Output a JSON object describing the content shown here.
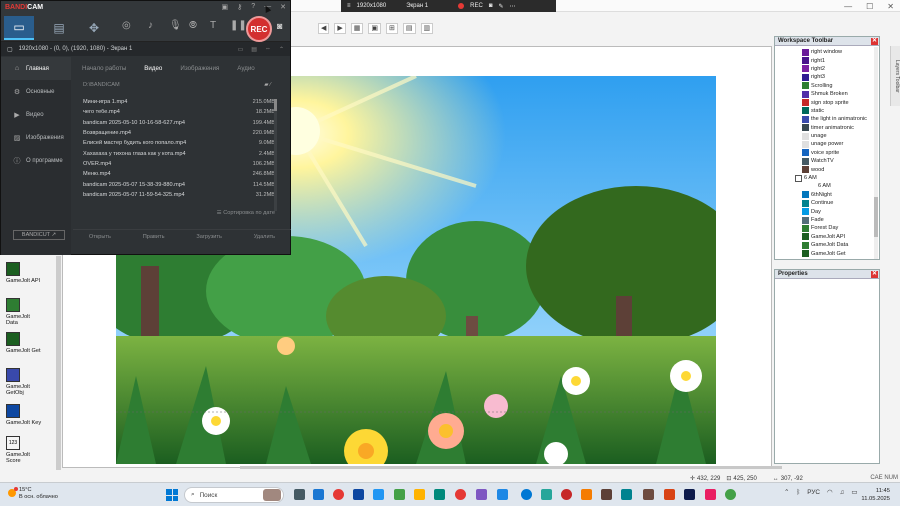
{
  "bandicam": {
    "logo_brand": "BANDI",
    "logo_brand2": "CAM",
    "rec_label": "REC",
    "area_text": "1920x1080 - (0, 0), (1920, 1080) - Экран 1",
    "sidebar": [
      {
        "label": "Главная",
        "icon": "home-icon"
      },
      {
        "label": "Основные",
        "icon": "gear-icon"
      },
      {
        "label": "Видео",
        "icon": "video-icon"
      },
      {
        "label": "Изображения",
        "icon": "image-icon"
      },
      {
        "label": "О программе",
        "icon": "info-icon"
      }
    ],
    "bandicut_label": "BANDICUT ↗",
    "tabs": [
      "Начало работы",
      "Видео",
      "Изображения",
      "Аудио"
    ],
    "active_tab": "Видео",
    "path": "D:\\BANDICAM",
    "files": [
      {
        "name": "Мини-игра 1.mp4",
        "size": "215.0MB"
      },
      {
        "name": "чего тебе.mp4",
        "size": "18.2MB"
      },
      {
        "name": "bandicam 2025-05-10 10-16-58-627.mp4",
        "size": "199.4MB"
      },
      {
        "name": "Возвращение.mp4",
        "size": "220.9MB"
      },
      {
        "name": "Елисей мастер будить кого попало.mp4",
        "size": "9.0MB"
      },
      {
        "name": "Хахахаха у тихона глаза как у кота.mp4",
        "size": "2.4MB"
      },
      {
        "name": "OVER.mp4",
        "size": "106.2MB"
      },
      {
        "name": "Меню.mp4",
        "size": "246.8MB"
      },
      {
        "name": "bandicam 2025-05-07 15-38-39-880.mp4",
        "size": "114.5MB"
      },
      {
        "name": "bandicam 2025-05-07 11-59-54-325.mp4",
        "size": "31.2MB"
      }
    ],
    "sort_label": "Сортировка по дате",
    "actions": [
      "Открыть",
      "Править",
      "Загрузить",
      "Удалить"
    ]
  },
  "editor": {
    "rec_bar_resolution": "1920x1080",
    "rec_bar_screen": "Экран 1",
    "rec_bar_rec": "REC",
    "status_coords": "432, 229",
    "status_size": "425, 250",
    "status_offset": "307, -92",
    "canvas_indicator": "CAE NUM",
    "layers_tab": "Layers Toolbar"
  },
  "workspace": {
    "title": "Workspace Toolbar",
    "items": [
      {
        "label": "right window",
        "level": 2
      },
      {
        "label": "right1",
        "level": 2
      },
      {
        "label": "right2",
        "level": 2
      },
      {
        "label": "right3",
        "level": 2
      },
      {
        "label": "Scrolling",
        "level": 2
      },
      {
        "label": "Shmuk Broken",
        "level": 2
      },
      {
        "label": "sign stop sprite",
        "level": 2
      },
      {
        "label": "static",
        "level": 2
      },
      {
        "label": "the light in animatronic",
        "level": 2
      },
      {
        "label": "timer animatronic",
        "level": 2
      },
      {
        "label": "unage",
        "level": 2
      },
      {
        "label": "unage power",
        "level": 2
      },
      {
        "label": "voice sprite",
        "level": 2
      },
      {
        "label": "WatchTV",
        "level": 2
      },
      {
        "label": "wood",
        "level": 2
      },
      {
        "label": "6 AM",
        "level": 1
      },
      {
        "label": "6 AM",
        "level": 3
      },
      {
        "label": "6thNight",
        "level": 2
      },
      {
        "label": "Continue",
        "level": 2
      },
      {
        "label": "Day",
        "level": 2
      },
      {
        "label": "Fade",
        "level": 2
      },
      {
        "label": "Forest Day",
        "level": 2
      },
      {
        "label": "GameJolt API",
        "level": 2
      },
      {
        "label": "GameJolt Data",
        "level": 2
      },
      {
        "label": "GameJolt Get",
        "level": 2
      }
    ]
  },
  "properties": {
    "title": "Properties"
  },
  "palette": [
    {
      "label": "GameJolt API"
    },
    {
      "label": "GameJolt Data"
    },
    {
      "label": "GameJolt Get"
    },
    {
      "label": "GameJolt GetObj"
    },
    {
      "label": "GameJolt Key"
    },
    {
      "label": "GameJolt Score",
      "glyph": "123"
    }
  ],
  "taskbar": {
    "weather_temp": "15°C",
    "weather_text": "В осн. облачно",
    "search_placeholder": "Поиск",
    "lang": "РУС",
    "time": "11:45",
    "date": "11.05.2025"
  },
  "colors": {
    "accent": "#0078d4",
    "rec": "#d32f2f",
    "bandicam_bg": "#2e3235"
  }
}
